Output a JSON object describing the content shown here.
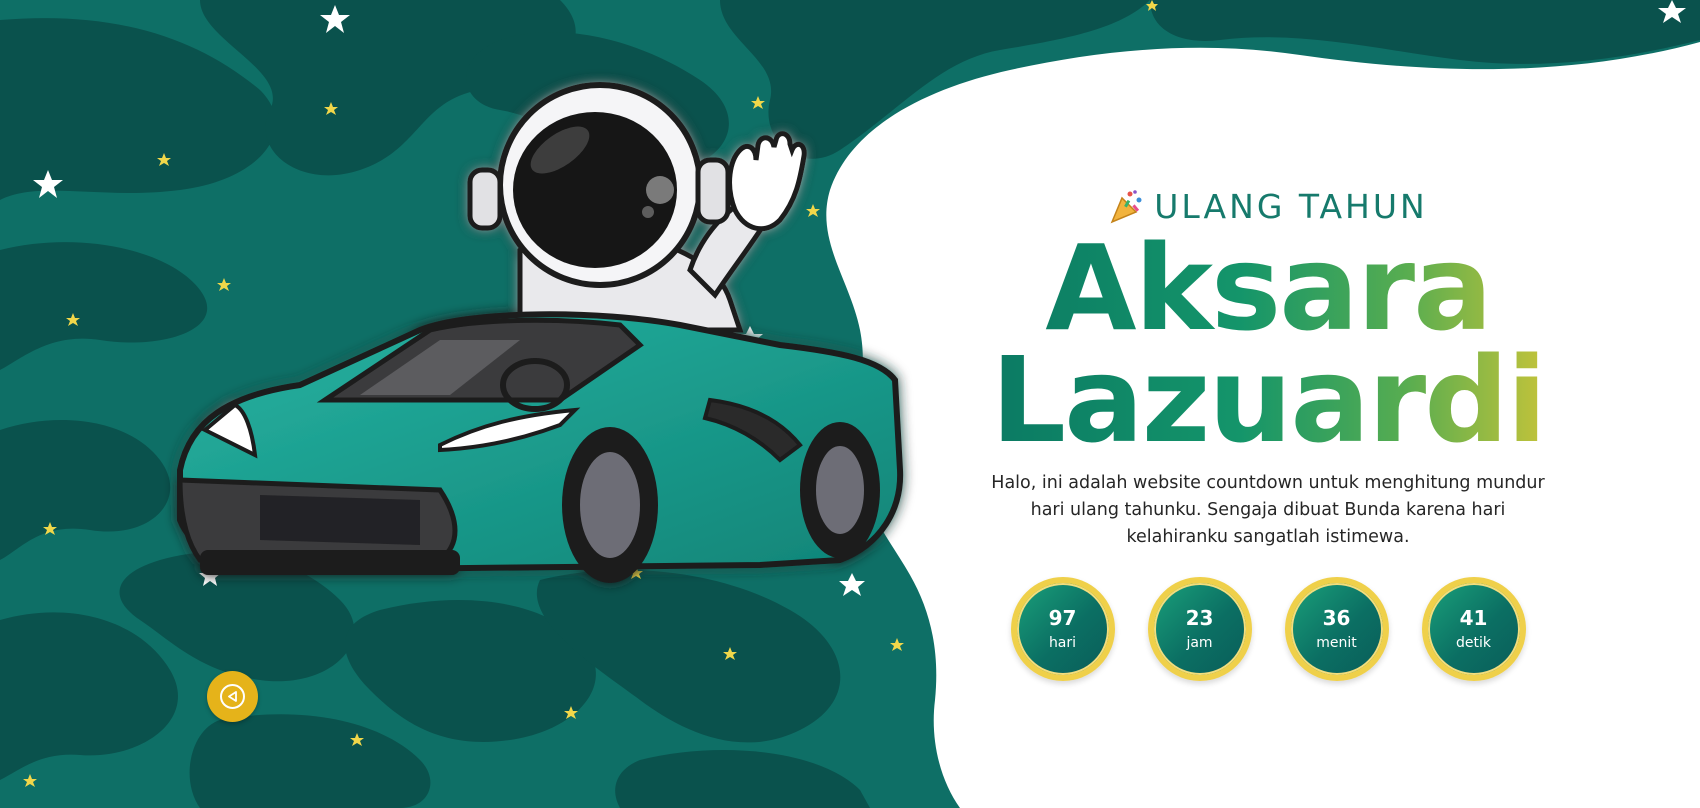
{
  "hero": {
    "eyebrow_icon": "party-popper-icon",
    "eyebrow": "ULANG TAHUN",
    "name_line1": "Aksara",
    "name_line2": "Lazuardi",
    "description": "Halo, ini adalah website countdown untuk menghitung mundur hari ulang tahunku. Sengaja dibuat Bunda karena hari kelahiranku sangatlah istimewa."
  },
  "countdown": {
    "days": {
      "value": "97",
      "unit": "hari"
    },
    "hours": {
      "value": "23",
      "unit": "jam"
    },
    "minutes": {
      "value": "36",
      "unit": "menit"
    },
    "seconds": {
      "value": "41",
      "unit": "detik"
    }
  },
  "music_button": {
    "icon": "play-music-icon"
  },
  "illustration": {
    "subject": "astronaut-in-teal-sports-car-icon",
    "background": "space-camouflage-with-stars"
  },
  "colors": {
    "background_teal": "#0e6f66",
    "blob_dark": "#0a514c",
    "car_teal": "#179a8c",
    "name_gradient_start": "#0b7a63",
    "name_gradient_end": "#c2c33a",
    "countdown_ring": "#efd04a",
    "star_yellow": "#f1d74a"
  }
}
